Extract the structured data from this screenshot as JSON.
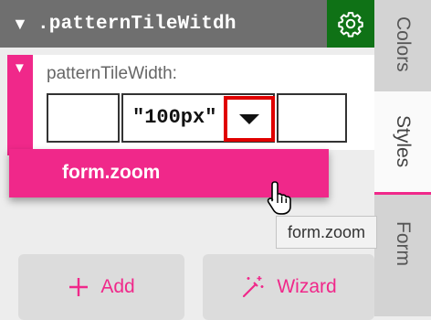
{
  "header": {
    "caret_glyph": "▼",
    "title": ".patternTileWitdh",
    "settings_icon": "gear-icon"
  },
  "side_tabs": {
    "colors": "Colors",
    "styles": "Styles",
    "form": "Form"
  },
  "property": {
    "caret_glyph": "▼",
    "label": "patternTileWidth:",
    "value": "\"100px\"",
    "dropdown_icon": "caret-down-icon"
  },
  "dropdown_menu": {
    "items": [
      "form.zoom"
    ]
  },
  "tooltip": {
    "text": "form.zoom"
  },
  "actions": {
    "add_label": "Add",
    "wizard_label": "Wizard"
  },
  "colors": {
    "accent": "#f0288a",
    "header_bg": "#6f6f6f",
    "gear_bg": "#0f7216",
    "highlight": "#e00000"
  }
}
